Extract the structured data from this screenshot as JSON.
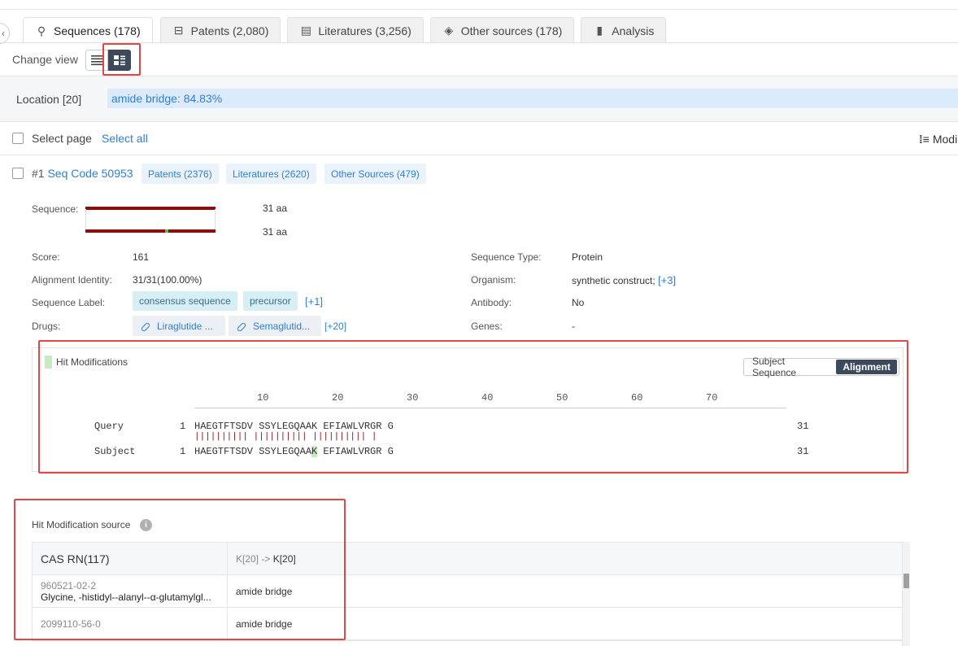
{
  "tabs": [
    {
      "label": "Sequences (178)",
      "icon": "dna-icon"
    },
    {
      "label": "Patents (2,080)",
      "icon": "patent-icon"
    },
    {
      "label": "Literatures (3,256)",
      "icon": "document-icon"
    },
    {
      "label": "Other sources (178)",
      "icon": "box-icon"
    },
    {
      "label": "Analysis",
      "icon": "bar-chart-icon"
    }
  ],
  "view": {
    "change_view_label": "Change view"
  },
  "location": {
    "label": "Location [20]",
    "chip": "amide bridge: 84.83%"
  },
  "selection": {
    "select_page": "Select page",
    "select_all": "Select all",
    "sort_label": "Modi"
  },
  "record": {
    "index": "#1",
    "code": "Seq Code 50953",
    "badges": [
      "Patents (2376)",
      "Literatures (2620)",
      "Other Sources (479)"
    ],
    "sequence_label": "Sequence:",
    "query_length": "31 aa",
    "subject_length": "31 aa",
    "fields": {
      "score_label": "Score:",
      "score": "161",
      "identity_label": "Alignment Identity:",
      "identity": "31/31(100.00%)",
      "seq_label_label": "Sequence Label:",
      "seq_labels": [
        "consensus sequence",
        "precursor"
      ],
      "seq_labels_more": "[+1]",
      "drugs_label": "Drugs:",
      "drugs": [
        "Liraglutide ...",
        "Semaglutid..."
      ],
      "drugs_more": "[+20]",
      "type_label": "Sequence Type:",
      "type": "Protein",
      "organism_label": "Organism:",
      "organism": "synthetic construct;",
      "organism_more": "[+3]",
      "antibody_label": "Antibody:",
      "antibody": "No",
      "genes_label": "Genes:",
      "genes": "-"
    }
  },
  "alignment": {
    "title": "Hit Modifications",
    "toggle": [
      "Subject Sequence",
      "Alignment"
    ],
    "ticks": [
      "10",
      "20",
      "30",
      "40",
      "50",
      "60",
      "70"
    ],
    "query_name": "Query",
    "subject_name": "Subject",
    "start": "1",
    "end": "31",
    "query_seq": "HAEGTFTSDV SSYLEGQAAK EFIAWLVRGR G",
    "match_line": "|||||||||| |||||||||| |||||||||| |",
    "subject_seq_a": "HAEGTFTSDV SSYLEGQAA",
    "subject_seq_hit": "K",
    "subject_seq_b": " EFIAWLVRGR G"
  },
  "source": {
    "title": "Hit Modification source",
    "col1": "CAS RN(117)",
    "col2_from": "K[20] ->",
    "col2_to": "K[20]",
    "rows": [
      {
        "cas": "960521-02-2",
        "name": "Glycine, -histidyl--alanyl--α-glutamylgl...",
        "mod": "amide bridge"
      },
      {
        "cas": "2099110-56-0",
        "name": "",
        "mod": "amide bridge"
      }
    ]
  }
}
